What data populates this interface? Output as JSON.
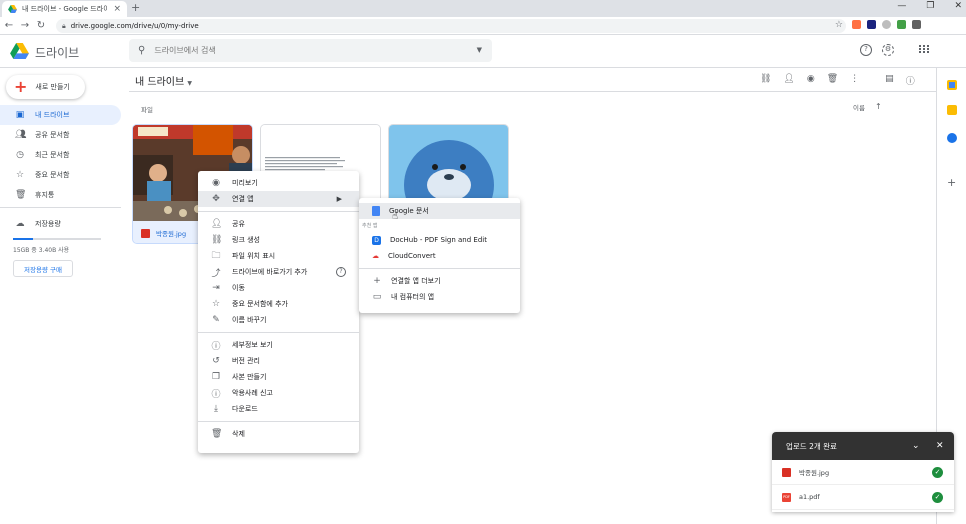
{
  "browser": {
    "tab_title": "내 드라이브 - Google 드라이브",
    "url": "drive.google.com/drive/u/0/my-drive"
  },
  "header": {
    "app_title": "드라이브",
    "search_placeholder": "드라이브에서 검색"
  },
  "sidebar": {
    "new_button": "새로 만들기",
    "items": [
      {
        "label": "내 드라이브",
        "icon": "drive-icon"
      },
      {
        "label": "공유 문서함",
        "icon": "people-icon"
      },
      {
        "label": "최근 문서함",
        "icon": "clock-icon"
      },
      {
        "label": "중요 문서함",
        "icon": "star-icon"
      },
      {
        "label": "휴지통",
        "icon": "trash-icon"
      }
    ],
    "storage_label": "저장용량",
    "storage_text": "15GB 중 3.40B 사용",
    "buy_storage": "저장용량 구매",
    "storage_fraction": 0.23
  },
  "main": {
    "breadcrumb": "내 드라이브",
    "section_label": "파일",
    "sort_label": "이름",
    "files": [
      {
        "name": "박종원.jpg"
      },
      {
        "name": ""
      },
      {
        "name": ""
      }
    ]
  },
  "context_menu": {
    "items": [
      {
        "label": "미리보기",
        "icon": "eye-icon"
      },
      {
        "label": "연결 앱",
        "icon": "open-with-icon"
      },
      {
        "label": "공유",
        "icon": "person-add-icon"
      },
      {
        "label": "링크 생성",
        "icon": "link-icon"
      },
      {
        "label": "파일 위치 표시",
        "icon": "folder-icon"
      },
      {
        "label": "드라이브에 바로가기 추가",
        "icon": "shortcut-icon"
      },
      {
        "label": "이동",
        "icon": "move-icon"
      },
      {
        "label": "중요 문서함에 추가",
        "icon": "star-icon"
      },
      {
        "label": "이름 바꾸기",
        "icon": "pencil-icon"
      },
      {
        "label": "세부정보 보기",
        "icon": "info-icon"
      },
      {
        "label": "버전 관리",
        "icon": "history-icon"
      },
      {
        "label": "사본 만들기",
        "icon": "copy-icon"
      },
      {
        "label": "악용사례 신고",
        "icon": "report-icon"
      },
      {
        "label": "다운로드",
        "icon": "download-icon"
      },
      {
        "label": "삭제",
        "icon": "trash-icon"
      }
    ]
  },
  "submenu": {
    "first": "Google 문서",
    "suggested_label": "추천 앱",
    "apps": [
      "DocHub - PDF Sign and Edit",
      "CloudConvert"
    ],
    "more": "연결할 앱 더보기",
    "computer": "내 컴퓨터의 앱"
  },
  "upload": {
    "title": "업로드 2개 완료",
    "files": [
      "박종원.jpg",
      "a1.pdf"
    ]
  }
}
